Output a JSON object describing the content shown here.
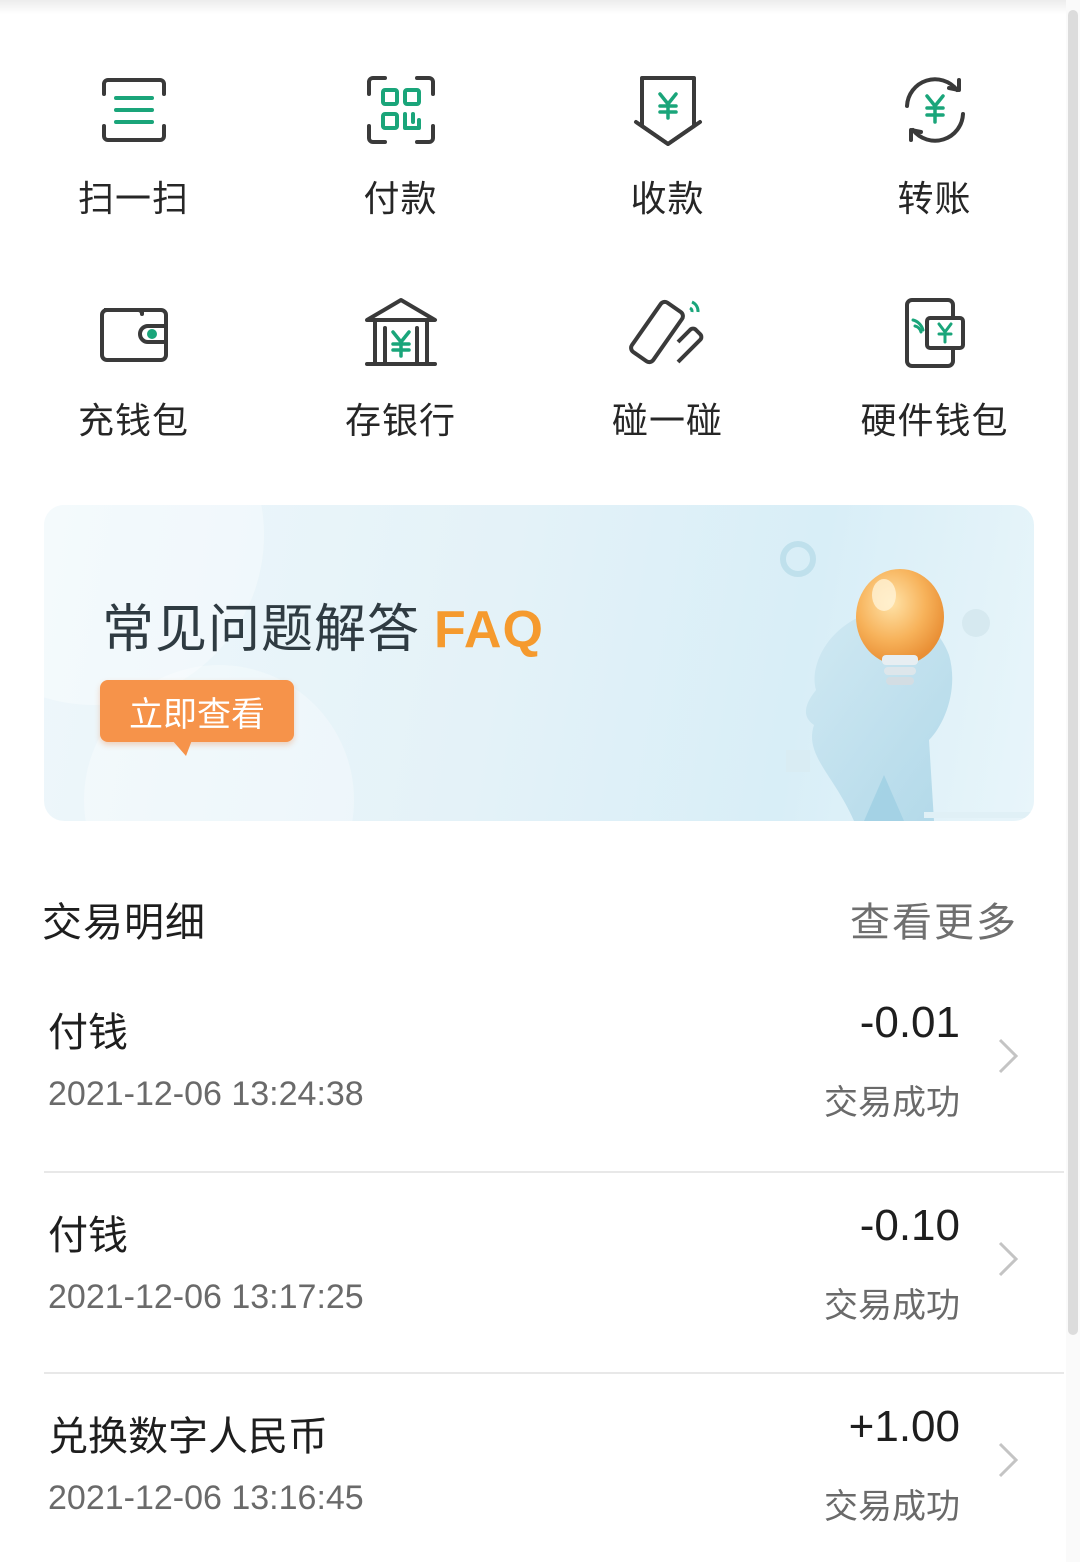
{
  "quick_actions": [
    {
      "label": "扫一扫",
      "icon": "scan-icon"
    },
    {
      "label": "付款",
      "icon": "qr-pay-icon"
    },
    {
      "label": "收款",
      "icon": "receive-money-icon"
    },
    {
      "label": "转账",
      "icon": "transfer-icon"
    },
    {
      "label": "充钱包",
      "icon": "wallet-topup-icon"
    },
    {
      "label": "存银行",
      "icon": "bank-deposit-icon"
    },
    {
      "label": "碰一碰",
      "icon": "tap-phone-icon"
    },
    {
      "label": "硬件钱包",
      "icon": "hardware-wallet-icon"
    }
  ],
  "banner": {
    "title": "常见问题解答",
    "title_suffix": "FAQ",
    "button_label": "立即查看"
  },
  "transactions": {
    "title": "交易明细",
    "more_label": "查看更多",
    "items": [
      {
        "name": "付钱",
        "time": "2021-12-06 13:24:38",
        "amount": "-0.01",
        "status": "交易成功"
      },
      {
        "name": "付钱",
        "time": "2021-12-06 13:17:25",
        "amount": "-0.10",
        "status": "交易成功"
      },
      {
        "name": "兑换数字人民币",
        "time": "2021-12-06 13:16:45",
        "amount": "+1.00",
        "status": "交易成功"
      }
    ]
  },
  "colors": {
    "accent_green": "#1aa57a",
    "icon_gray": "#3a3a3a",
    "faq_orange": "#f59a2e",
    "button_orange": "#f6934a"
  }
}
